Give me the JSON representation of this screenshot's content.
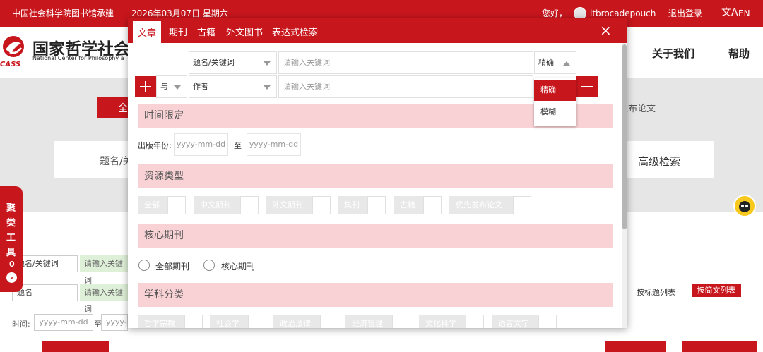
{
  "topbar": {
    "org": "中国社会科学院图书馆承建",
    "date": "2026年03月07日 星期六",
    "greeting": "您好，",
    "username": "itbrocadepouch",
    "logout": "退出登录",
    "lang": "EN"
  },
  "header": {
    "logo_cn": "国家哲学社会",
    "logo_en": "National Center for Philosophy a",
    "logo_abbr": "CASS",
    "nav": [
      "关于我们",
      "帮助"
    ]
  },
  "background": {
    "tab_fragment": "全",
    "pub_fragment": "发布论文",
    "field_fragment": "题名/关",
    "advanced": "高级检索",
    "side_tool": [
      "聚",
      "类",
      "工",
      "具"
    ],
    "side_count": "0",
    "row1_select": "题名/关键词",
    "row1_input": "请输入关键词",
    "row2_select": "题名",
    "row2_input": "请输入关键词",
    "time_label": "时间:",
    "time_from": "yyyy-mm-dd",
    "time_sep": "至",
    "time_to": "yyyy-",
    "list_title": "按标题列表",
    "list_abstract": "按简文列表"
  },
  "modal": {
    "tabs": [
      "文章",
      "期刊",
      "古籍",
      "外文图书",
      "表达式检索"
    ],
    "close": "×",
    "row1": {
      "field": "题名/关键词",
      "placeholder": "请输入关键词",
      "match": "精确"
    },
    "row2": {
      "logic": "与",
      "field": "作者",
      "placeholder": "请输入关键词"
    },
    "match_options": [
      "精确",
      "模糊"
    ],
    "sections": {
      "time": "时间限定",
      "resource": "资源类型",
      "core": "核心期刊",
      "subject": "学科分类"
    },
    "year_label": "出版年份:",
    "year_from": "yyyy-mm-dd",
    "year_sep": "至",
    "year_to": "yyyy-mm-dd",
    "resource_types": [
      "全部",
      "中文期刊",
      "外文期刊",
      "集刊",
      "古籍",
      "优先发布论文"
    ],
    "core_options": [
      "全部期刊",
      "核心期刊"
    ],
    "subjects": [
      "哲学宗教",
      "社会学",
      "政治法律",
      "经济管理",
      "文化科学",
      "语言文字"
    ]
  },
  "colors": {
    "brand": "#c8161d",
    "section_bg": "#f9d2d5"
  }
}
